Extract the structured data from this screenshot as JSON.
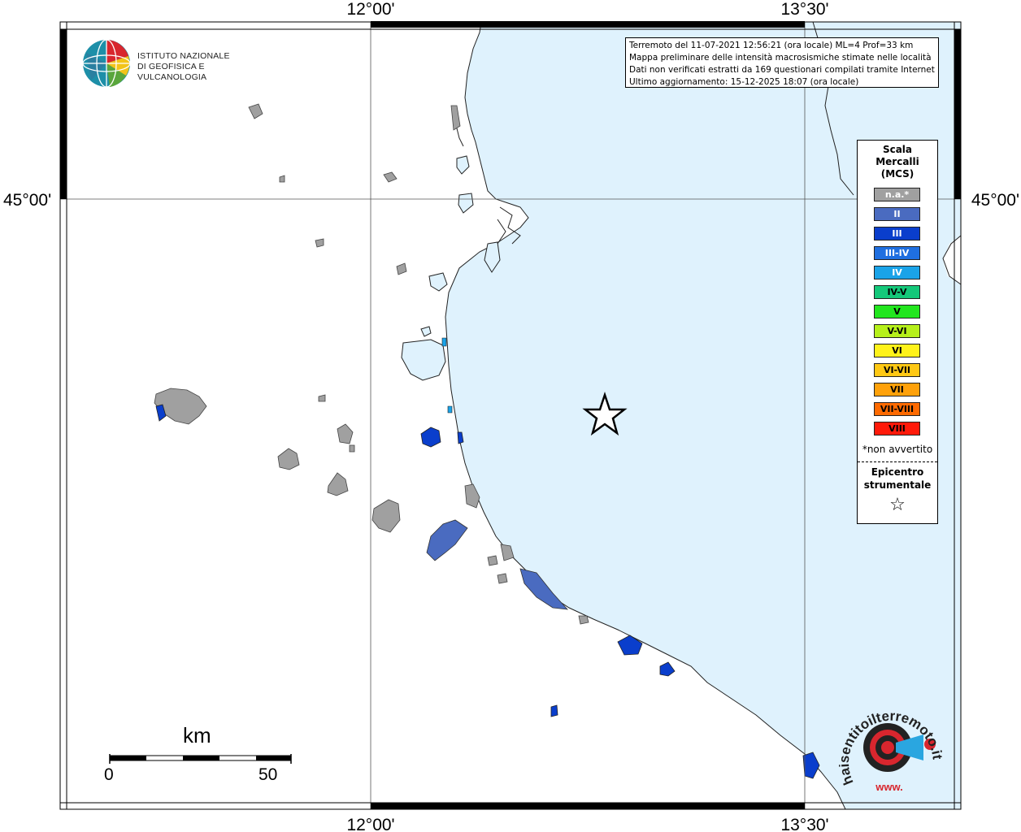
{
  "map": {
    "coordinates": {
      "lon_left": "12°00'",
      "lon_right": "13°30'",
      "lat": "45°00'"
    },
    "colors": {
      "sea": "#dff2fd",
      "land": "#ffffff",
      "na": "#a0a0a0",
      "II": "#4a6bc0",
      "III": "#0a3ecc"
    }
  },
  "info": {
    "line1": "Terremoto del 11-07-2021 12:56:21 (ora locale) ML=4 Prof=33 km",
    "line2": "Mappa preliminare delle intensità macrosismiche stimate nelle località",
    "line3": "Dati non verificati estratti da 169 questionari compilati tramite Internet.",
    "line4": "Ultimo aggiornamento: 15-12-2025 18:07 (ora locale)"
  },
  "legend": {
    "title_line1": "Scala",
    "title_line2": "Mercalli",
    "title_line3": "(MCS)",
    "items": [
      {
        "label": "n.a.*",
        "color": "#a0a0a0",
        "text": "light"
      },
      {
        "label": "II",
        "color": "#4a6bc0",
        "text": "light"
      },
      {
        "label": "III",
        "color": "#0a3ecc",
        "text": "light"
      },
      {
        "label": "III-IV",
        "color": "#1f6fe0",
        "text": "light"
      },
      {
        "label": "IV",
        "color": "#1aa3e8",
        "text": "light"
      },
      {
        "label": "IV-V",
        "color": "#14c87a",
        "text": "dark"
      },
      {
        "label": "V",
        "color": "#22e61e",
        "text": "dark"
      },
      {
        "label": "V-VI",
        "color": "#b6f01a",
        "text": "dark"
      },
      {
        "label": "VI",
        "color": "#fff21a",
        "text": "dark"
      },
      {
        "label": "VI-VII",
        "color": "#ffc814",
        "text": "dark"
      },
      {
        "label": "VII",
        "color": "#ffa10a",
        "text": "dark"
      },
      {
        "label": "VII-VIII",
        "color": "#ff6a00",
        "text": "dark"
      },
      {
        "label": "VIII",
        "color": "#ff1a0a",
        "text": "dark"
      }
    ],
    "note": "*non avvertito",
    "epicenter_line1": "Epicentro",
    "epicenter_line2": "strumentale",
    "epicenter_symbol": "☆"
  },
  "ingv": {
    "line1": "ISTITUTO NAZIONALE",
    "line2": "DI GEOFISICA E VULCANOLOGIA"
  },
  "scalebar": {
    "unit": "km",
    "start": "0",
    "end": "50"
  },
  "hst": {
    "text": "haisentitoilterremoto.it",
    "url_text": "www."
  }
}
